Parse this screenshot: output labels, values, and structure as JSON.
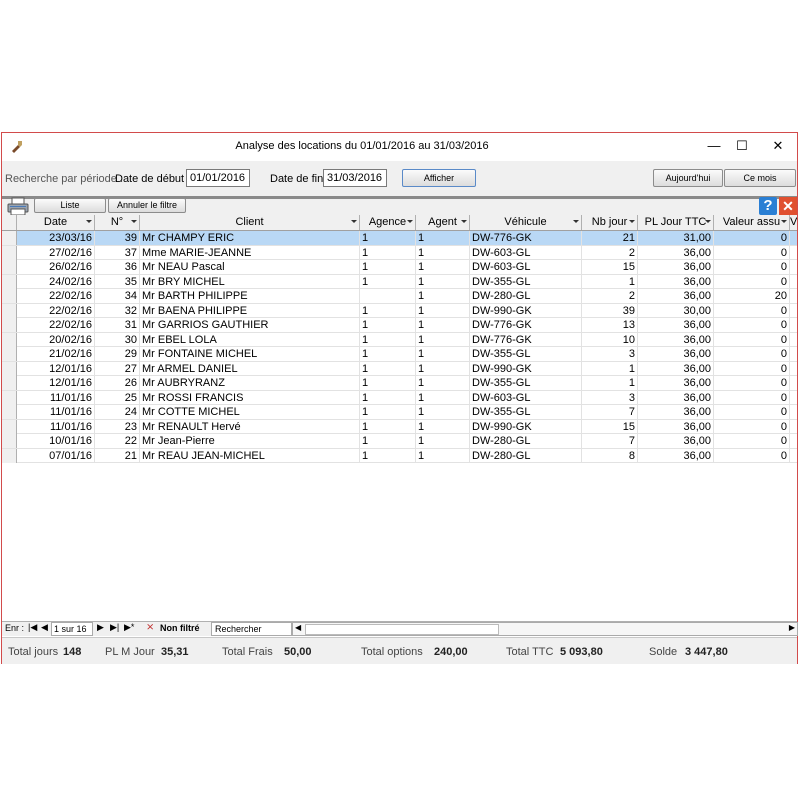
{
  "window": {
    "title": "Analyse des locations du 01/01/2016 au 31/03/2016"
  },
  "toolbar": {
    "search_label": "Recherche par période :",
    "date_debut_label": "Date de début :",
    "date_debut_value": "01/01/2016",
    "date_fin_label": "Date de fin :",
    "date_fin_value": "31/03/2016",
    "afficher_label": "Afficher",
    "aujourdhui_label": "Aujourd'hui",
    "ce_mois_label": "Ce mois"
  },
  "subbar": {
    "liste_label": "Liste",
    "annuler_label": "Annuler le filtre"
  },
  "columns": [
    "Date",
    "N°",
    "Client",
    "Agence",
    "Agent",
    "Véhicule",
    "Nb jour",
    "PL Jour TTC",
    "Valeur assu",
    "V"
  ],
  "rows": [
    {
      "date": "23/03/16",
      "num": "39",
      "client": "Mr CHAMPY ERIC",
      "agence": "1",
      "agent": "1",
      "vehicule": "DW-776-GK",
      "nb_jour": "21",
      "pl_jour": "31,00",
      "valeur": "0"
    },
    {
      "date": "27/02/16",
      "num": "37",
      "client": "Mme MARIE-JEANNE",
      "agence": "1",
      "agent": "1",
      "vehicule": "DW-603-GL",
      "nb_jour": "2",
      "pl_jour": "36,00",
      "valeur": "0"
    },
    {
      "date": "26/02/16",
      "num": "36",
      "client": "Mr NEAU Pascal",
      "agence": "1",
      "agent": "1",
      "vehicule": "DW-603-GL",
      "nb_jour": "15",
      "pl_jour": "36,00",
      "valeur": "0"
    },
    {
      "date": "24/02/16",
      "num": "35",
      "client": "Mr BRY MICHEL",
      "agence": "1",
      "agent": "1",
      "vehicule": "DW-355-GL",
      "nb_jour": "1",
      "pl_jour": "36,00",
      "valeur": "0"
    },
    {
      "date": "22/02/16",
      "num": "34",
      "client": "Mr BARTH PHILIPPE",
      "agence": "",
      "agent": "1",
      "vehicule": "DW-280-GL",
      "nb_jour": "2",
      "pl_jour": "36,00",
      "valeur": "20"
    },
    {
      "date": "22/02/16",
      "num": "32",
      "client": "Mr BAENA PHILIPPE",
      "agence": "1",
      "agent": "1",
      "vehicule": "DW-990-GK",
      "nb_jour": "39",
      "pl_jour": "30,00",
      "valeur": "0"
    },
    {
      "date": "22/02/16",
      "num": "31",
      "client": "Mr GARRIOS GAUTHIER",
      "agence": "1",
      "agent": "1",
      "vehicule": "DW-776-GK",
      "nb_jour": "13",
      "pl_jour": "36,00",
      "valeur": "0"
    },
    {
      "date": "20/02/16",
      "num": "30",
      "client": "Mr EBEL LOLA",
      "agence": "1",
      "agent": "1",
      "vehicule": "DW-776-GK",
      "nb_jour": "10",
      "pl_jour": "36,00",
      "valeur": "0"
    },
    {
      "date": "21/02/16",
      "num": "29",
      "client": "Mr FONTAINE MICHEL",
      "agence": "1",
      "agent": "1",
      "vehicule": "DW-355-GL",
      "nb_jour": "3",
      "pl_jour": "36,00",
      "valeur": "0"
    },
    {
      "date": "12/01/16",
      "num": "27",
      "client": "Mr ARMEL DANIEL",
      "agence": "1",
      "agent": "1",
      "vehicule": "DW-990-GK",
      "nb_jour": "1",
      "pl_jour": "36,00",
      "valeur": "0"
    },
    {
      "date": "12/01/16",
      "num": "26",
      "client": "Mr AUBRYRANZ",
      "agence": "1",
      "agent": "1",
      "vehicule": "DW-355-GL",
      "nb_jour": "1",
      "pl_jour": "36,00",
      "valeur": "0"
    },
    {
      "date": "11/01/16",
      "num": "25",
      "client": "Mr ROSSI FRANCIS",
      "agence": "1",
      "agent": "1",
      "vehicule": "DW-603-GL",
      "nb_jour": "3",
      "pl_jour": "36,00",
      "valeur": "0"
    },
    {
      "date": "11/01/16",
      "num": "24",
      "client": "Mr COTTE MICHEL",
      "agence": "1",
      "agent": "1",
      "vehicule": "DW-355-GL",
      "nb_jour": "7",
      "pl_jour": "36,00",
      "valeur": "0"
    },
    {
      "date": "11/01/16",
      "num": "23",
      "client": "Mr RENAULT Hervé",
      "agence": "1",
      "agent": "1",
      "vehicule": "DW-990-GK",
      "nb_jour": "15",
      "pl_jour": "36,00",
      "valeur": "0"
    },
    {
      "date": "10/01/16",
      "num": "22",
      "client": "Mr Jean-Pierre",
      "agence": "1",
      "agent": "1",
      "vehicule": "DW-280-GL",
      "nb_jour": "7",
      "pl_jour": "36,00",
      "valeur": "0"
    },
    {
      "date": "07/01/16",
      "num": "21",
      "client": "Mr REAU   JEAN-MICHEL",
      "agence": "1",
      "agent": "1",
      "vehicule": "DW-280-GL",
      "nb_jour": "8",
      "pl_jour": "36,00",
      "valeur": "0"
    }
  ],
  "navbar": {
    "enr_label": "Enr :",
    "record_value": "1 sur 16",
    "filter_label": "Non filtré",
    "search_label": "Rechercher"
  },
  "footer": {
    "total_jours_label": "Total jours",
    "total_jours_value": "148",
    "pl_m_jour_label": "PL M Jour",
    "pl_m_jour_value": "35,31",
    "total_frais_label": "Total Frais",
    "total_frais_value": "50,00",
    "total_options_label": "Total options",
    "total_options_value": "240,00",
    "total_ttc_label": "Total TTC",
    "total_ttc_value": "5 093,80",
    "solde_label": "Solde",
    "solde_value": "3 447,80"
  }
}
